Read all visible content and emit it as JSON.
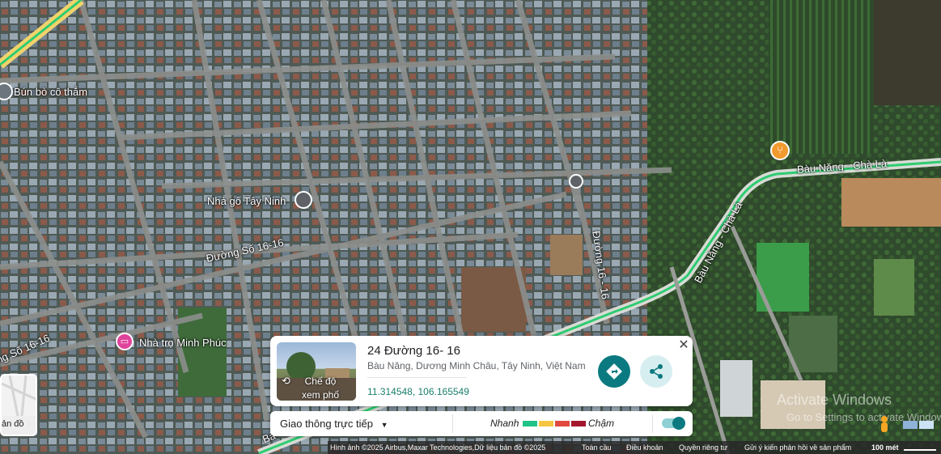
{
  "place_labels": {
    "bun_bo": "Bún bò cô thắm",
    "nha_go": "Nhà gô Tây Ninh",
    "nha_tro": "Nhà trọ Minh Phúc"
  },
  "road_labels": {
    "duong_so": "Đường Số 16-16",
    "duong_16": "Đường 16 - 16",
    "bau_nang_1": "Bàu Năng - Chà Là",
    "bau_nang_2": "Bàu Năng - Chà Là",
    "left_road": "ng Số 16-16",
    "bottom_partial": "Bà"
  },
  "card": {
    "title": "24 Đường 16- 16",
    "address": "Bàu Năng, Dương Minh Châu, Tây Ninh, Việt Nam",
    "coords": "11.314548, 106.165549",
    "street_view_label": "Chế độ xem phố"
  },
  "traffic": {
    "label": "Giao thông trực tiếp",
    "fast": "Nhanh",
    "slow": "Chậm",
    "colors": [
      "#1ec485",
      "#f5c542",
      "#e0483e",
      "#a3162e"
    ]
  },
  "street_view_thumb_label": "ản đồ",
  "footer": {
    "imagery": "Hình ảnh ©2025 Airbus,Maxar Technologies,Dữ liệu bản đồ ©2025",
    "global": "Toàn cầu",
    "terms": "Điều khoản",
    "privacy": "Quyền riêng tư",
    "feedback": "Gửi ý kiến phản hồi về sản phẩm",
    "scale": "100 mét"
  },
  "watermark": {
    "line1": "Activate Windows",
    "line2": "Go to Settings to activate Windows."
  },
  "icons": [
    "pin-icon",
    "restaurant-icon",
    "hotel-icon",
    "street-view-icon",
    "directions-icon",
    "share-icon",
    "close-icon",
    "dropdown-icon",
    "pegman-icon",
    "layers-icon"
  ],
  "colors": {
    "accent": "#0b7a80",
    "coords": "#1a7f6b",
    "road_green": "#2ecc71",
    "hotel_pin": "#e0439b",
    "restaurant_pin": "#f29a2e"
  }
}
